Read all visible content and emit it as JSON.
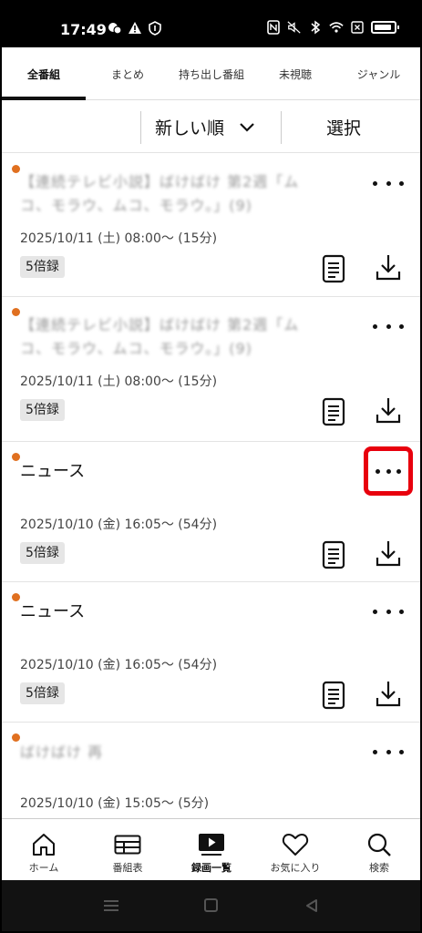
{
  "status_bar": {
    "time": "17:49",
    "icons_left": [
      "dnd-icon",
      "warning-icon",
      "shield-icon"
    ],
    "icons_right": [
      "nfc-icon",
      "mute-icon",
      "bluetooth-icon",
      "wifi-icon",
      "close-box-icon",
      "battery-icon"
    ]
  },
  "tabs": [
    {
      "label": "全番組",
      "active": true
    },
    {
      "label": "まとめ",
      "active": false
    },
    {
      "label": "持ち出し番組",
      "active": false
    },
    {
      "label": "未視聴",
      "active": false
    },
    {
      "label": "ジャンル",
      "active": false
    }
  ],
  "sort": {
    "selected": "新しい順",
    "select_button": "選択"
  },
  "recordings": [
    {
      "title_line1": "【連続テレビ小説】ばけばけ 第2週「ム",
      "title_line2": "コ、モラウ、ムコ、モラウ。」(9)",
      "blurred": true,
      "date": "2025/10/11 (土) 08:00〜 (15分)",
      "badge": "5倍録",
      "unread": true
    },
    {
      "title_line1": "【連続テレビ小説】ばけばけ 第2週「ム",
      "title_line2": "コ、モラウ、ムコ、モラウ。」(9)",
      "blurred": true,
      "date": "2025/10/11 (土) 08:00〜 (15分)",
      "badge": "5倍録",
      "unread": true
    },
    {
      "title_line1": "ニュース",
      "title_line2": "",
      "blurred": false,
      "date": "2025/10/10 (金) 16:05〜 (54分)",
      "badge": "5倍録",
      "unread": true,
      "highlighted": true
    },
    {
      "title_line1": "ニュース",
      "title_line2": "",
      "blurred": false,
      "date": "2025/10/10 (金) 16:05〜 (54分)",
      "badge": "5倍録",
      "unread": true
    },
    {
      "title_line1": "ばけばけ 再",
      "title_line2": "",
      "blurred": true,
      "date": "2025/10/10 (金) 15:05〜 (5分)",
      "badge": "",
      "unread": true
    }
  ],
  "bottom_nav": [
    {
      "label": "ホーム",
      "icon": "home-icon",
      "active": false
    },
    {
      "label": "番組表",
      "icon": "grid-icon",
      "active": false
    },
    {
      "label": "録画一覧",
      "icon": "play-icon",
      "active": true
    },
    {
      "label": "お気に入り",
      "icon": "heart-icon",
      "active": false
    },
    {
      "label": "検索",
      "icon": "search-icon",
      "active": false
    }
  ],
  "colors": {
    "unread_dot": "#e07020",
    "highlight": "#e8000d"
  }
}
